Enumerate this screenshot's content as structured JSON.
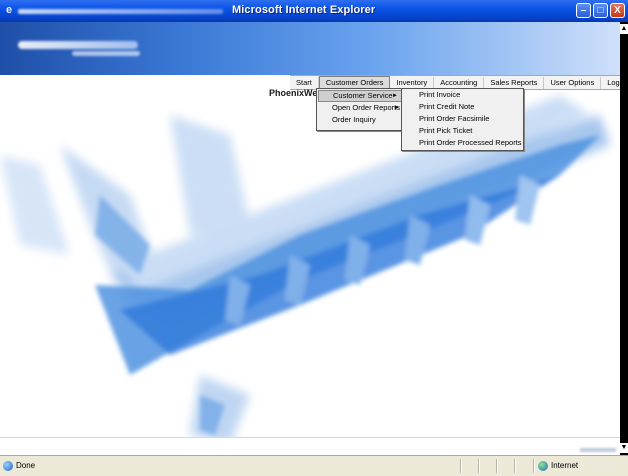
{
  "window": {
    "title": "Microsoft Internet Explorer",
    "minimize": "–",
    "maximize": "□",
    "close": "X",
    "ie_glyph": "e"
  },
  "menubar": {
    "items": [
      "Start",
      "Customer Orders",
      "Inventory",
      "Accounting",
      "Sales Reports",
      "User Options",
      "Log Out"
    ],
    "active_index": 1
  },
  "app_label": "PhoenixWe",
  "customer_orders_menu": {
    "items": [
      {
        "label": "Customer Service",
        "submenu": true,
        "selected": true
      },
      {
        "label": "Open Order Reports",
        "submenu": true,
        "selected": false
      },
      {
        "label": "Order Inquiry",
        "submenu": false,
        "selected": false
      }
    ]
  },
  "customer_service_menu": {
    "items": [
      "Print Invoice",
      "Print Credit Note",
      "Print Order Facsimile",
      "Print Pick Ticket",
      "Print Order Processed Reports"
    ]
  },
  "submenu_arrow": "►",
  "scroll": {
    "up": "▲",
    "down": "▼"
  },
  "status": {
    "text": "Done",
    "zone": "Internet"
  },
  "colors": {
    "titlebar": "#0a53e6",
    "banner": "#3b79d6",
    "menubar_bg": "#f3f3f3",
    "dropdown_bg": "#f0f0f0",
    "status_bg": "#ece9d8"
  }
}
